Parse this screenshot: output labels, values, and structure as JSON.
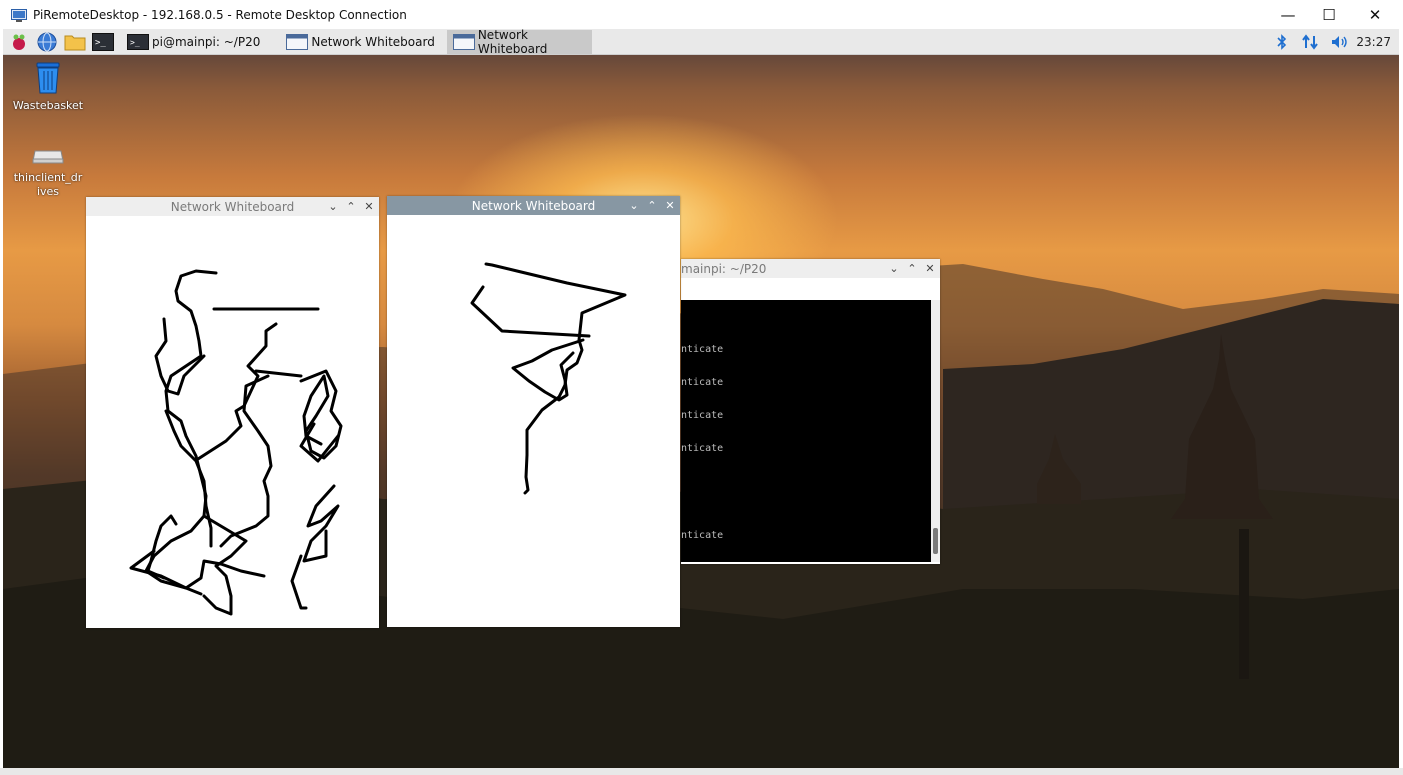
{
  "rdp": {
    "title": "PiRemoteDesktop - 192.168.0.5 - Remote Desktop Connection",
    "minimize": "—",
    "maximize": "☐",
    "close": "✕"
  },
  "panel": {
    "launchers": [
      "raspberry-menu-icon",
      "web-browser-icon",
      "file-manager-icon",
      "terminal-icon"
    ],
    "tasks": [
      {
        "label": "pi@mainpi: ~/P20",
        "icon": "terminal-icon",
        "active": false
      },
      {
        "label": "Network Whiteboard",
        "icon": "window-icon",
        "active": false
      },
      {
        "label": "Network Whiteboard",
        "icon": "window-icon",
        "active": true
      }
    ],
    "tray": [
      "bluetooth-icon",
      "network-icon",
      "volume-icon"
    ],
    "clock": "23:27"
  },
  "desktop_icons": [
    {
      "label": "Wastebasket",
      "icon": "wastebasket-icon"
    },
    {
      "label": "thinclient_drives",
      "icon": "drive-icon"
    }
  ],
  "windows": {
    "whiteboard1": {
      "title": "Network Whiteboard"
    },
    "whiteboard2": {
      "title": "Network Whiteboard"
    },
    "terminal": {
      "title": "mainpi: ~/P20",
      "lines": [
        "nticate",
        "nticate",
        "nticate",
        "nticate",
        "nticate"
      ]
    }
  },
  "window_buttons": {
    "minimize": "⌄",
    "maximize": "⌃",
    "close": "✕"
  },
  "colors": {
    "active_titlebar": "#8797a3",
    "panel": "#e9e9e9"
  }
}
